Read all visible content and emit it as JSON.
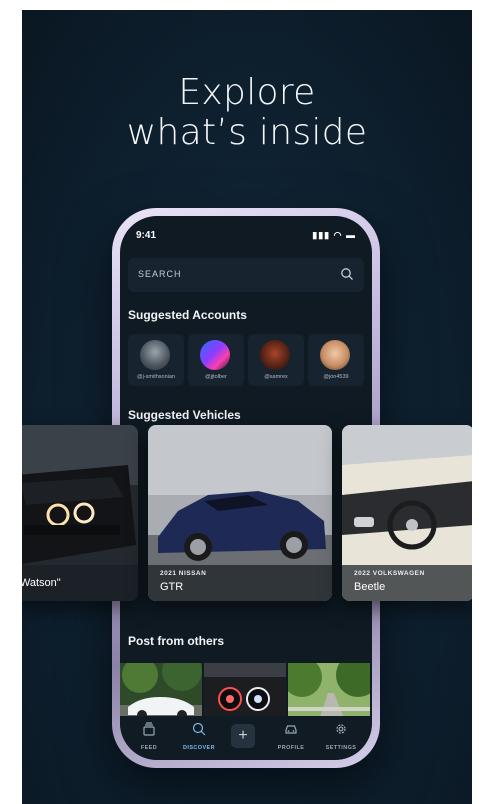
{
  "headline": {
    "line1": "Explore",
    "line2": "what’s inside"
  },
  "status": {
    "time": "9:41",
    "icons": "▮▮▮ ◠ ▬"
  },
  "search": {
    "placeholder": "SEARCH",
    "icon": "search-icon"
  },
  "suggested_accounts": {
    "title": "Suggested Accounts",
    "items": [
      {
        "handle": "@j-smithsonian"
      },
      {
        "handle": "@jjtolber"
      },
      {
        "handle": "@samrex"
      },
      {
        "handle": "@jon4539"
      }
    ]
  },
  "suggested_vehicles": {
    "title": "Suggested Vehicles",
    "items": [
      {
        "year_make": "",
        "model": "\"Watson\""
      },
      {
        "year_make": "2021 NISSAN",
        "model": "GTR"
      },
      {
        "year_make": "2022 VOLKSWAGEN",
        "model": "Beetle"
      }
    ]
  },
  "posts": {
    "title": "Post from others"
  },
  "tabbar": {
    "items": [
      {
        "label": "FEED",
        "icon": "feed-icon"
      },
      {
        "label": "DISCOVER",
        "icon": "search-icon"
      },
      {
        "label": "+",
        "icon": "add-icon"
      },
      {
        "label": "PROFILE",
        "icon": "car-icon"
      },
      {
        "label": "SETTINGS",
        "icon": "gear-icon"
      }
    ],
    "active": "DISCOVER"
  },
  "colors": {
    "accent": "#7eb8e8",
    "background": "#0f2232",
    "card": "#17242f"
  }
}
